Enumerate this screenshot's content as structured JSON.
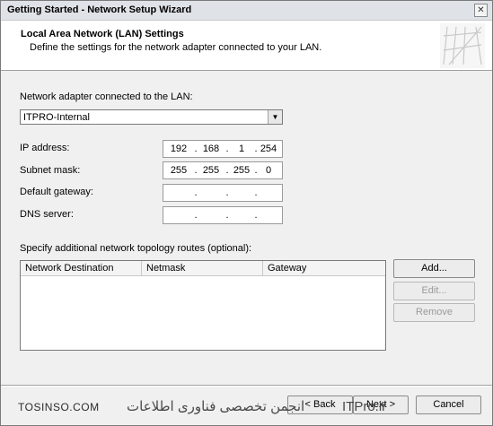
{
  "window": {
    "title": "Getting Started - Network Setup Wizard",
    "close_glyph": "✕"
  },
  "header": {
    "title": "Local Area Network (LAN) Settings",
    "subtitle": "Define the settings for the network adapter connected to your LAN."
  },
  "adapter": {
    "label": "Network adapter connected to the LAN:",
    "selected": "ITPRO-Internal"
  },
  "fields": {
    "ip": {
      "label": "IP address:",
      "octets": [
        "192",
        "168",
        "1",
        "254"
      ]
    },
    "subnet": {
      "label": "Subnet mask:",
      "octets": [
        "255",
        "255",
        "255",
        "0"
      ]
    },
    "gateway": {
      "label": "Default gateway:",
      "octets": [
        "",
        "",
        "",
        ""
      ]
    },
    "dns": {
      "label": "DNS server:",
      "octets": [
        "",
        "",
        "",
        ""
      ]
    }
  },
  "routes": {
    "label": "Specify additional network topology routes (optional):",
    "columns": [
      "Network Destination",
      "Netmask",
      "Gateway"
    ],
    "rows": []
  },
  "side_buttons": {
    "add": "Add...",
    "edit": "Edit...",
    "remove": "Remove"
  },
  "footer": {
    "back": "< Back",
    "next": "Next >",
    "cancel": "Cancel"
  },
  "watermark": {
    "left": "TOSINSO.COM",
    "center": "انجمن تخصصی فناوری اطلاعات",
    "right": "ITPro.ir"
  }
}
